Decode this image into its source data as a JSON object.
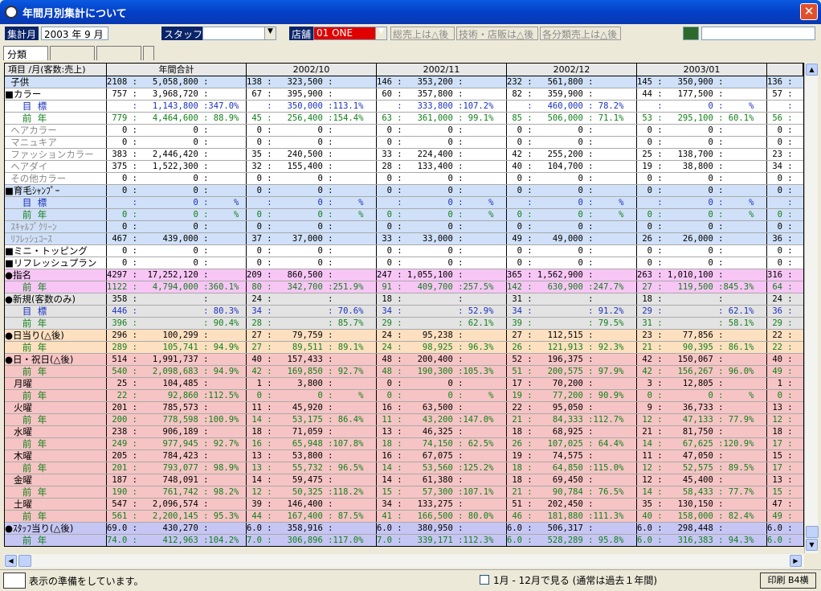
{
  "window": {
    "title": "年間月別集計について",
    "close": "✕"
  },
  "toolbar": {
    "period_label": "集計月",
    "period_value": "2003 年  9 月",
    "staff_label": "スタッフ",
    "staff_value": "",
    "store_label": "店舗",
    "store_value": "01 ONE",
    "chk1": "総売上は△後",
    "chk2": "技術・店販は△後",
    "chk3": "各分類売上は△後",
    "search_value": ""
  },
  "tabs": [
    "分類",
    "",
    "",
    ""
  ],
  "header": [
    "項目 /月(客数:売上)",
    "年間合計",
    "2002/10",
    "2002/11",
    "2002/12",
    "2003/01",
    ""
  ],
  "rows": [
    {
      "t": "b",
      "cls": "",
      "l": "  子供",
      "c": [
        "2108 :   5,058,800 :",
        "138 :   323,500 :",
        "146 :   353,200 :",
        "232 :   561,800 :",
        "145 :   350,900 :",
        "136 :"
      ]
    },
    {
      "t": "w",
      "cls": "",
      "l": "■カラー",
      "c": [
        " 757 :   3,968,720 :",
        " 67 :   395,900 :",
        " 60 :   357,800 :",
        " 82 :   359,900 :",
        " 44 :   177,500 :",
        " 57 :"
      ]
    },
    {
      "t": "w",
      "cls": "blue",
      "l": "      目  標",
      "c": [
        "     :   1,143,800 :347.0%",
        "    :   350,000 :113.1%",
        "    :   333,800 :107.2%",
        "    :   460,000 : 78.2%",
        "    :         0 :     %",
        "    :"
      ]
    },
    {
      "t": "w",
      "cls": "green",
      "l": "      前  年",
      "c": [
        " 779 :   4,464,600 : 88.9%",
        " 45 :   256,400 :154.4%",
        " 63 :   361,000 : 99.1%",
        " 85 :   506,000 : 71.1%",
        " 53 :   295,100 : 60.1%",
        " 56 :"
      ]
    },
    {
      "t": "w",
      "cls": "",
      "l": "  ヘアカラー",
      "g": 1,
      "c": [
        "   0 :           0 :",
        "  0 :         0 :",
        "  0 :         0 :",
        "  0 :         0 :",
        "  0 :         0 :",
        "  0 :"
      ]
    },
    {
      "t": "w",
      "cls": "",
      "l": "  マニュキア",
      "g": 1,
      "c": [
        "   0 :           0 :",
        "  0 :         0 :",
        "  0 :         0 :",
        "  0 :         0 :",
        "  0 :         0 :",
        "  0 :"
      ]
    },
    {
      "t": "w",
      "cls": "",
      "l": "  ファッションカラー",
      "g": 1,
      "c": [
        " 383 :   2,446,420 :",
        " 35 :   240,500 :",
        " 33 :   224,400 :",
        " 42 :   255,200 :",
        " 25 :   138,700 :",
        " 23 :"
      ]
    },
    {
      "t": "w",
      "cls": "",
      "l": "  ヘアダイ",
      "g": 1,
      "c": [
        " 375 :   1,522,300 :",
        " 32 :   155,400 :",
        " 28 :   133,400 :",
        " 40 :   104,700 :",
        " 19 :    38,800 :",
        " 34 :"
      ]
    },
    {
      "t": "w",
      "cls": "",
      "l": "  その他カラー",
      "g": 1,
      "c": [
        "   0 :           0 :",
        "  0 :         0 :",
        "  0 :         0 :",
        "  0 :         0 :",
        "  0 :         0 :",
        "  0 :"
      ]
    },
    {
      "t": "b",
      "cls": "",
      "l": "■育毛ｼｬﾝﾌﾟｰ",
      "c": [
        "   0 :           0 :",
        "  0 :         0 :",
        "  0 :         0 :",
        "  0 :         0 :",
        "  0 :         0 :",
        "  0 :"
      ]
    },
    {
      "t": "b",
      "cls": "blue",
      "l": "      目  標",
      "c": [
        "     :           0 :     %",
        "    :         0 :     %",
        "    :         0 :     %",
        "    :         0 :     %",
        "    :         0 :     %",
        "    :"
      ]
    },
    {
      "t": "b",
      "cls": "green",
      "l": "      前  年",
      "c": [
        "   0 :           0 :     %",
        "  0 :         0 :     %",
        "  0 :         0 :     %",
        "  0 :         0 :     %",
        "  0 :         0 :     %",
        "  0 :"
      ]
    },
    {
      "t": "b",
      "cls": "",
      "l": "  ｽｷｬﾙﾌﾟｸﾘｰﾝ",
      "g": 1,
      "c": [
        "   0 :           0 :",
        "  0 :         0 :",
        "  0 :         0 :",
        "  0 :         0 :",
        "  0 :         0 :",
        "  0 :"
      ]
    },
    {
      "t": "b",
      "cls": "",
      "l": "  ﾘﾌﾚｯｼｭｺｰｽ",
      "g": 1,
      "c": [
        " 467 :     439,000 :",
        " 37 :    37,000 :",
        " 33 :    33,000 :",
        " 49 :    49,000 :",
        " 26 :    26,000 :",
        " 36 :"
      ]
    },
    {
      "t": "w",
      "cls": "",
      "l": "■ミニ・トッピング",
      "c": [
        "   0 :           0 :",
        "  0 :         0 :",
        "  0 :         0 :",
        "  0 :         0 :",
        "  0 :         0 :",
        "  0 :"
      ]
    },
    {
      "t": "w",
      "cls": "",
      "l": "■リフレッシュプラン",
      "c": [
        "   0 :           0 :",
        "  0 :         0 :",
        "  0 :         0 :",
        "  0 :         0 :",
        "  0 :         0 :",
        "  0 :"
      ]
    },
    {
      "t": "p",
      "cls": "",
      "l": "●指名",
      "c": [
        "4297 :  17,252,120 :",
        "209 :   860,500 :",
        "247 : 1,055,100 :",
        "365 : 1,562,900 :",
        "263 : 1,010,100 :",
        "316 :"
      ]
    },
    {
      "t": "p",
      "cls": "green",
      "l": "      前  年",
      "c": [
        "1122 :   4,794,000 :360.1%",
        " 80 :   342,700 :251.9%",
        " 91 :   409,700 :257.5%",
        "142 :   630,900 :247.7%",
        " 27 :   119,500 :845.3%",
        " 64 :"
      ]
    },
    {
      "t": "g",
      "cls": "",
      "l": "●新規(客数のみ)",
      "c": [
        " 358 :             :",
        " 24 :           :",
        " 18 :           :",
        " 31 :           :",
        " 18 :           :",
        " 24 :"
      ]
    },
    {
      "t": "g",
      "cls": "blue",
      "l": "      目  標",
      "c": [
        " 446 :             : 80.3%",
        " 34 :           : 70.6%",
        " 34 :           : 52.9%",
        " 34 :           : 91.2%",
        " 29 :           : 62.1%",
        " 36 :"
      ]
    },
    {
      "t": "g",
      "cls": "green",
      "l": "      前  年",
      "c": [
        " 396 :             : 90.4%",
        " 28 :           : 85.7%",
        " 29 :           : 62.1%",
        " 39 :           : 79.5%",
        " 31 :           : 58.1%",
        " 29 :"
      ]
    },
    {
      "t": "o",
      "cls": "",
      "l": "●日当り(△後)",
      "c": [
        " 296 :     100,299 :",
        " 27 :    79,759 :",
        " 24 :    95,238 :",
        " 27 :   112,515 :",
        " 23 :    77,856 :",
        " 22 :"
      ]
    },
    {
      "t": "o",
      "cls": "green",
      "l": "      前  年",
      "c": [
        " 289 :     105,741 : 94.9%",
        " 27 :    89,511 : 89.1%",
        " 24 :    98,925 : 96.3%",
        " 26 :   121,913 : 92.3%",
        " 21 :    90,395 : 86.1%",
        " 22 :"
      ]
    },
    {
      "t": "r",
      "cls": "",
      "l": "●日・祝日(△後)",
      "c": [
        " 514 :   1,991,737 :",
        " 40 :   157,433 :",
        " 48 :   200,400 :",
        " 52 :   196,375 :",
        " 42 :   150,067 :",
        " 40 :"
      ]
    },
    {
      "t": "r",
      "cls": "green",
      "l": "      前  年",
      "c": [
        " 540 :   2,098,683 : 94.9%",
        " 42 :   169,850 : 92.7%",
        " 48 :   190,300 :105.3%",
        " 51 :   200,575 : 97.9%",
        " 42 :   156,267 : 96.0%",
        " 49 :"
      ]
    },
    {
      "t": "r",
      "cls": "",
      "l": "   月曜",
      "c": [
        "  25 :     104,485 :",
        "  1 :     3,800 :",
        "  0 :         0 :",
        " 17 :    70,200 :",
        "  3 :    12,805 :",
        "  1 :"
      ]
    },
    {
      "t": "r",
      "cls": "green",
      "l": "      前  年",
      "c": [
        "  22 :      92,860 :112.5%",
        "  0 :         0 :     %",
        "  0 :         0 :     %",
        " 19 :    77,200 : 90.9%",
        "  0 :         0 :     %",
        "  0 :"
      ]
    },
    {
      "t": "r",
      "cls": "",
      "l": "   火曜",
      "c": [
        " 201 :     785,573 :",
        " 11 :    45,920 :",
        " 16 :    63,500 :",
        " 22 :    95,050 :",
        "  9 :    36,733 :",
        " 13 :"
      ]
    },
    {
      "t": "r",
      "cls": "green",
      "l": "      前  年",
      "c": [
        " 200 :     778,598 :100.9%",
        " 14 :    53,175 : 86.4%",
        " 11 :    43,200 :147.0%",
        " 21 :    84,333 :112.7%",
        " 12 :    47,133 : 77.9%",
        " 12 :"
      ]
    },
    {
      "t": "r",
      "cls": "",
      "l": "   水曜",
      "c": [
        " 238 :     906,189 :",
        " 18 :    71,059 :",
        " 13 :    46,325 :",
        " 18 :    68,925 :",
        " 21 :    81,750 :",
        " 18 :"
      ]
    },
    {
      "t": "r",
      "cls": "green",
      "l": "      前  年",
      "c": [
        " 249 :     977,945 : 92.7%",
        " 16 :    65,948 :107.8%",
        " 18 :    74,150 : 62.5%",
        " 26 :   107,025 : 64.4%",
        " 14 :    67,625 :120.9%",
        " 17 :"
      ]
    },
    {
      "t": "r",
      "cls": "",
      "l": "   木曜",
      "c": [
        " 205 :     784,423 :",
        " 13 :    53,800 :",
        " 16 :    67,075 :",
        " 19 :    74,575 :",
        " 11 :    47,050 :",
        " 15 :"
      ]
    },
    {
      "t": "r",
      "cls": "green",
      "l": "      前  年",
      "c": [
        " 201 :     793,077 : 98.9%",
        " 13 :    55,732 : 96.5%",
        " 14 :    53,560 :125.2%",
        " 18 :    64,850 :115.0%",
        " 12 :    52,575 : 89.5%",
        " 17 :"
      ]
    },
    {
      "t": "r",
      "cls": "",
      "l": "   金曜",
      "c": [
        " 187 :     748,091 :",
        " 14 :    59,475 :",
        " 14 :    61,380 :",
        " 18 :    69,450 :",
        " 12 :    45,400 :",
        " 13 :"
      ]
    },
    {
      "t": "r",
      "cls": "green",
      "l": "      前  年",
      "c": [
        " 190 :     761,742 : 98.2%",
        " 12 :    50,325 :118.2%",
        " 15 :    57,300 :107.1%",
        " 21 :    90,784 : 76.5%",
        " 14 :    58,433 : 77.7%",
        " 15 :"
      ]
    },
    {
      "t": "r",
      "cls": "",
      "l": "   土曜",
      "c": [
        " 547 :   2,096,574 :",
        " 39 :   146,400 :",
        " 34 :   133,275 :",
        " 51 :   202,450 :",
        " 35 :   130,150 :",
        " 47 :"
      ]
    },
    {
      "t": "r",
      "cls": "green",
      "l": "      前  年",
      "c": [
        " 561 :   2,200,145 : 95.3%",
        " 44 :   167,400 : 87.5%",
        " 41 :   166,500 : 80.0%",
        " 46 :   181,880 :111.3%",
        " 40 :   158,000 : 82.4%",
        " 49 :"
      ]
    },
    {
      "t": "v",
      "cls": "",
      "l": "●ｽﾀｯﾌ当り(△後)",
      "c": [
        "69.0 :     430,270 :",
        "6.0 :   358,916 :",
        "6.0 :   380,950 :",
        "6.0 :   506,317 :",
        "6.0 :   298,448 :",
        "6.0 :"
      ]
    },
    {
      "t": "v",
      "cls": "green",
      "l": "      前  年",
      "c": [
        "74.0 :     412,963 :104.2%",
        "7.0 :   306,896 :117.0%",
        "7.0 :   339,171 :112.3%",
        "6.0 :   528,289 : 95.8%",
        "6.0 :   316,383 : 94.3%",
        "6.0 :"
      ]
    }
  ],
  "status": {
    "message": "表示の準備をしています。",
    "checkbox_label": "1月 - 12月で見る (通常は過去１年間)",
    "print_label": "印刷 B4横"
  },
  "colors": {
    "titlebar": "#0440c8",
    "blue_row": "#cfe0f8",
    "pink_row": "#f7c6f5",
    "gray_row": "#e3e3e3",
    "orange_row": "#fde0c0",
    "red_row": "#f6c4c4",
    "violet_row": "#c6c6f4",
    "target_text": "#1a30c0",
    "prev_year_text": "#108018"
  }
}
